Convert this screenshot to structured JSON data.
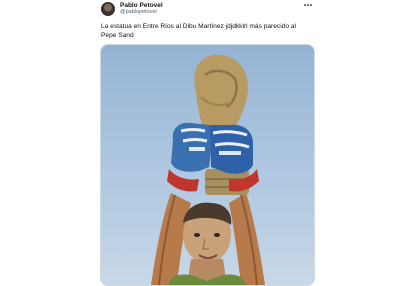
{
  "author": {
    "name": "Pablo Petovel",
    "handle": "@pablopetovel"
  },
  "tweet": {
    "text": "La estatua en Entre Ríos al Dibu Martínez jdjdkklrl más parecido al Pepe Sand"
  },
  "icons": {
    "avatar": "user-avatar",
    "more": "more-options-icon"
  },
  "colors": {
    "text": "#0f1419",
    "secondary_text": "#536471",
    "sky": "#a7c1dd"
  }
}
